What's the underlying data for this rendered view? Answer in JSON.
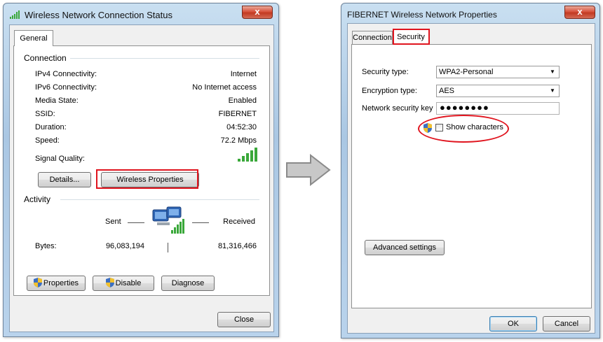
{
  "left": {
    "title": "Wireless Network Connection Status",
    "tab": "General",
    "connection": {
      "heading": "Connection",
      "rows": [
        {
          "label": "IPv4 Connectivity:",
          "value": "Internet"
        },
        {
          "label": "IPv6 Connectivity:",
          "value": "No Internet access"
        },
        {
          "label": "Media State:",
          "value": "Enabled"
        },
        {
          "label": "SSID:",
          "value": "FIBERNET"
        },
        {
          "label": "Duration:",
          "value": "04:52:30"
        },
        {
          "label": "Speed:",
          "value": "72.2 Mbps"
        }
      ],
      "signal_label": "Signal Quality:",
      "details_btn": "Details...",
      "wireless_props_btn": "Wireless Properties"
    },
    "activity": {
      "heading": "Activity",
      "sent": "Sent",
      "received": "Received",
      "bytes_label": "Bytes:",
      "bytes_sent": "96,083,194",
      "bytes_received": "81,316,466"
    },
    "buttons": {
      "properties": "Properties",
      "disable": "Disable",
      "diagnose": "Diagnose",
      "close": "Close"
    }
  },
  "right": {
    "title": "FIBERNET Wireless Network Properties",
    "tabs": [
      "Connection",
      "Security"
    ],
    "security_type_label": "Security type:",
    "security_type_value": "WPA2-Personal",
    "encryption_type_label": "Encryption type:",
    "encryption_type_value": "AES",
    "key_label": "Network security key",
    "key_value": "●●●●●●●●",
    "show_chars": "Show characters",
    "advanced_btn": "Advanced settings",
    "ok": "OK",
    "cancel": "Cancel"
  },
  "close_glyph": "x",
  "colors": {
    "highlight": "#e0141e",
    "window_frame": "#b9d3ec",
    "signal": "#3aa83a"
  }
}
